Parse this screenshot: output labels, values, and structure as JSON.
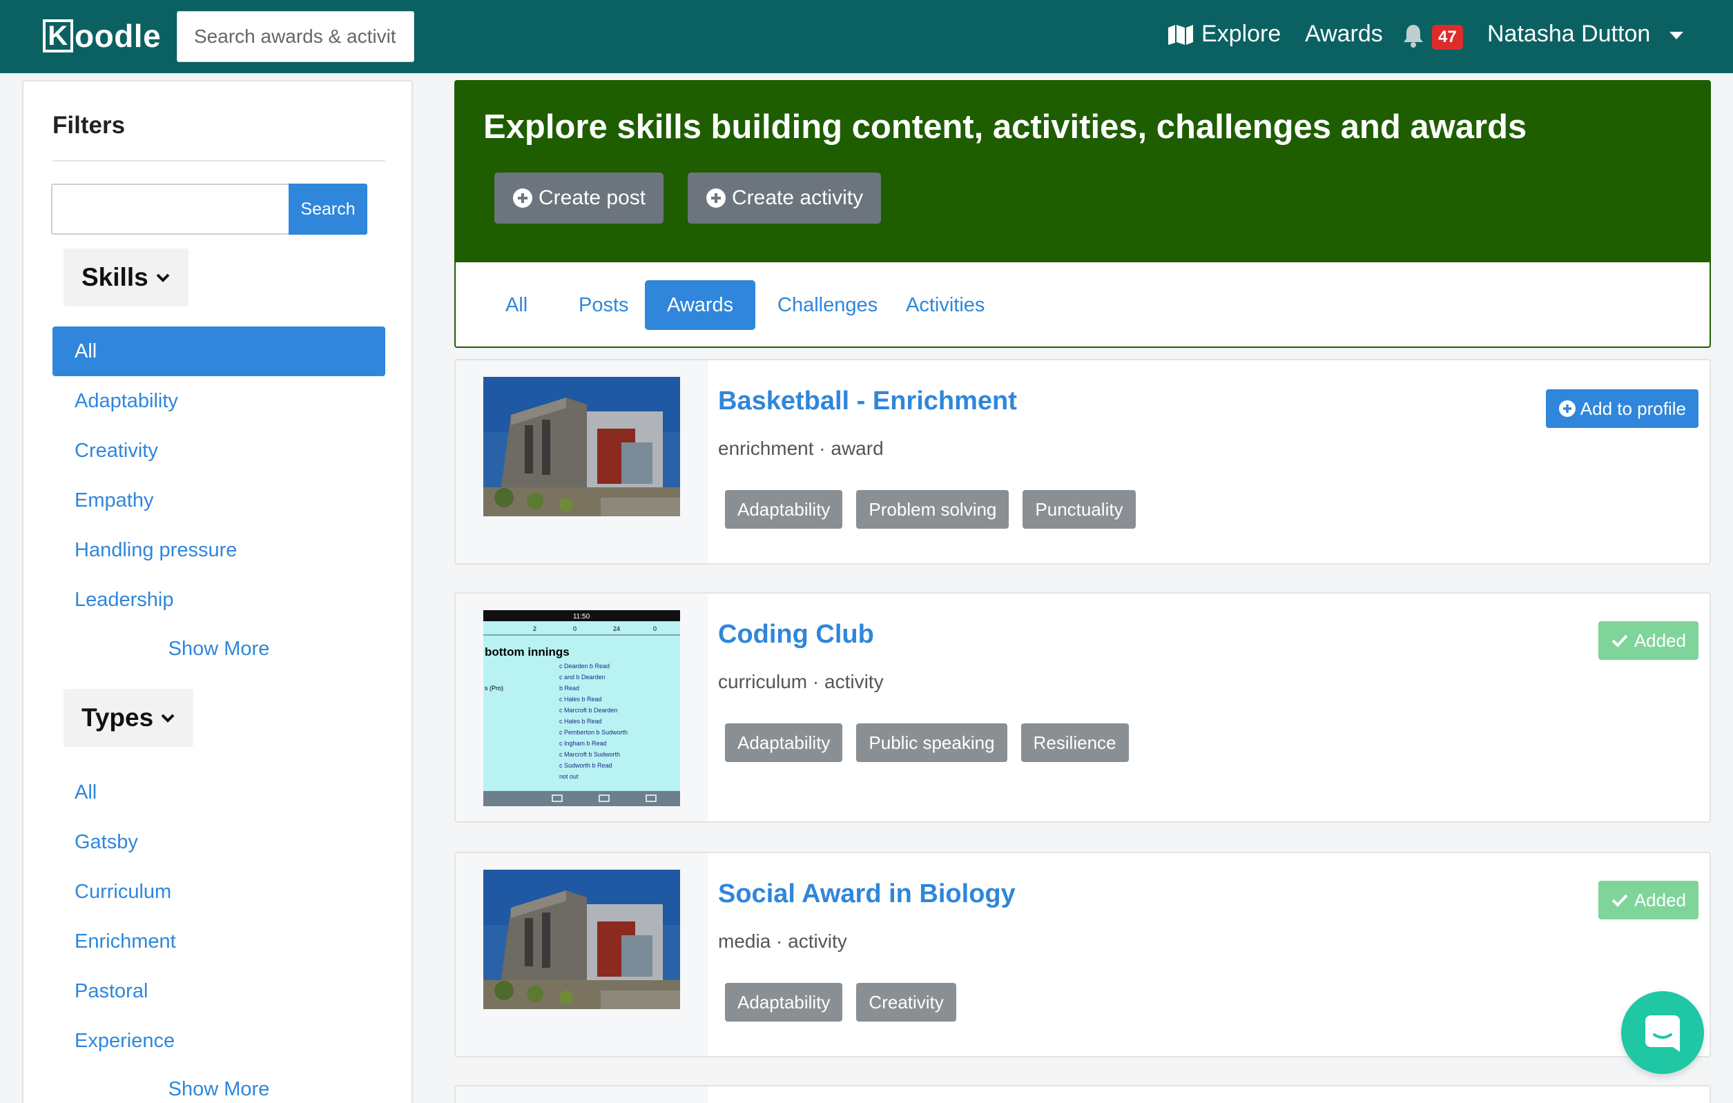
{
  "nav": {
    "logo_text": "oodle",
    "logo_letter": "K",
    "search_placeholder": "Search awards & activities",
    "explore_label": "Explore",
    "awards_label": "Awards",
    "notification_count": "47",
    "user_name": "Natasha Dutton"
  },
  "sidebar": {
    "title": "Filters",
    "search_button": "Search",
    "skills": {
      "toggle_label": "Skills",
      "items": [
        "All",
        "Adaptability",
        "Creativity",
        "Empathy",
        "Handling pressure",
        "Leadership"
      ],
      "active_index": 0,
      "show_more": "Show More"
    },
    "types": {
      "toggle_label": "Types",
      "items": [
        "All",
        "Gatsby",
        "Curriculum",
        "Enrichment",
        "Pastoral",
        "Experience"
      ],
      "show_more": "Show More"
    }
  },
  "hero": {
    "title": "Explore skills building content, activities, challenges and awards",
    "create_post": "Create post",
    "create_activity": "Create activity"
  },
  "tabs": {
    "items": [
      "All",
      "Posts",
      "Awards",
      "Challenges",
      "Activities"
    ],
    "active_index": 2
  },
  "cards": [
    {
      "title": "Basketball - Enrichment",
      "meta": "enrichment · award",
      "tags": [
        "Adaptability",
        "Problem solving",
        "Punctuality"
      ],
      "action": "Add to profile",
      "image": "building-photo"
    },
    {
      "title": "Coding Club",
      "meta": "curriculum · activity",
      "tags": [
        "Adaptability",
        "Public speaking",
        "Resilience"
      ],
      "action": "Added",
      "image": "scorecard-screenshot",
      "image_text": {
        "time": "11:50",
        "heading": "bottom innings",
        "cols": [
          "2",
          "0",
          "24",
          "0"
        ],
        "pro": "s (Pro)",
        "rows": [
          "c Dearden b Read",
          "c and b Dearden",
          "b Read",
          "c Hales b Read",
          "c Marcroft b Dearden",
          "c Hales b Read",
          "c Pemberton b Sudworth",
          "c Ingham b Read",
          "c Marcroft b Sudworth",
          "c Sudworth b Read",
          "not out"
        ]
      }
    },
    {
      "title": "Social Award in Biology",
      "meta": "media · activity",
      "tags": [
        "Adaptability",
        "Creativity"
      ],
      "action": "Added",
      "image": "building-photo"
    }
  ]
}
